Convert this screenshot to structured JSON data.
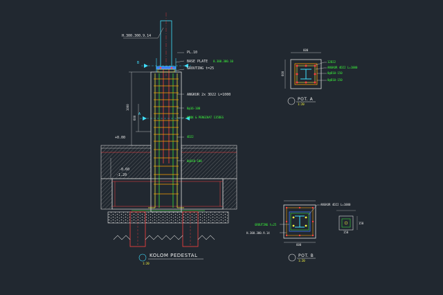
{
  "labels": {
    "profile_h": "H.300.300.9.14",
    "pl": "PL.10",
    "base_plate": "BASE PLATE",
    "base_plate_dim": "8.300.300.10",
    "grouting": "GROUTING t=25",
    "angkur": "ANGKUR 2x 3D22 L=1000",
    "tie_a": "8@16-100",
    "stirrup_note": "HOOK & PENGIKAT 135DEG",
    "main_bar": "4D22",
    "tie_b": "8@D10-100",
    "sec_b": "B",
    "sec_a": "A",
    "lev_pos": "+0.00",
    "lev_neg1": "-0.60",
    "lev_neg2": "-1.20",
    "dim_vertical": "1000",
    "dim_side": "600",
    "dim_pot_top": "600",
    "dim_pot_side": "600"
  },
  "pot_a": {
    "bars": "12D22",
    "angkur": "ANGKUR 4D22 L=1000",
    "tie1": "8@D10-150",
    "tie2": "8@D10-150",
    "title": "POT. A",
    "scale": "1:20"
  },
  "pot_b": {
    "angkur": "ANGKUR 4D22 L=1000",
    "grouting": "GROUTING t=25",
    "profile": "H.300.300.9.14",
    "dim_bottom": "600",
    "title": "POT. B",
    "scale": "1:20",
    "detail_dim1": "150",
    "detail_dim2": "150"
  },
  "main_title": "KOLOM PEDESTAL",
  "main_scale": "1:20"
}
